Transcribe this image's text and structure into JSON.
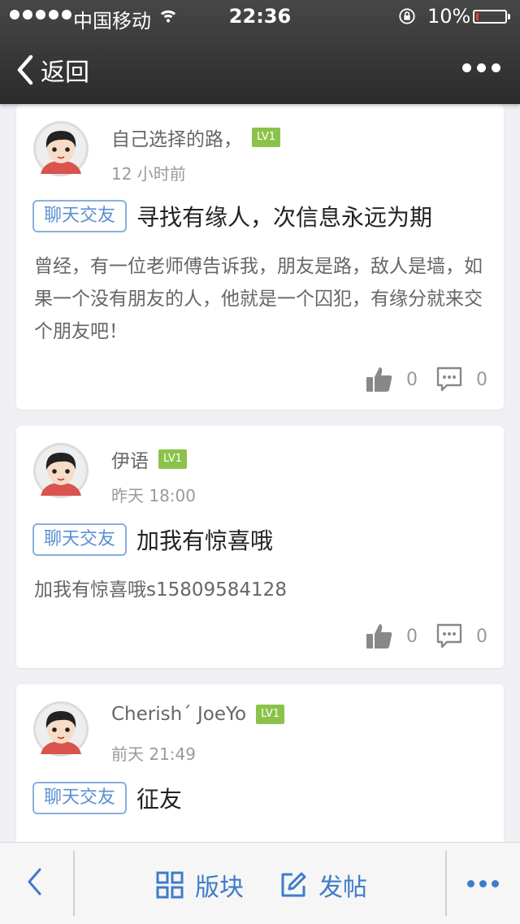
{
  "status": {
    "carrier": "中国移动",
    "time": "22:36",
    "battery": "10%",
    "battery_level": 0.1
  },
  "nav": {
    "back_label": "返回"
  },
  "posts": [
    {
      "author": "自己选择的路，",
      "level": "LV1",
      "time": "12 小时前",
      "tag": "聊天交友",
      "title": "寻找有缘人，次信息永远为期",
      "content": "曾经，有一位老师傅告诉我，朋友是路，敌人是墙，如果一个没有朋友的人，他就是一个囚犯，有缘分就来交个朋友吧！",
      "likes": "0",
      "comments": "0"
    },
    {
      "author": "伊语",
      "level": "LV1",
      "time": "昨天 18:00",
      "tag": "聊天交友",
      "title": "加我有惊喜哦",
      "content": "加我有惊喜哦s15809584128",
      "likes": "0",
      "comments": "0"
    },
    {
      "author": "Cherish´ JoeYo",
      "level": "LV1",
      "time": "前天 21:49",
      "tag": "聊天交友",
      "title": "征友"
    }
  ],
  "tabbar": {
    "board_label": "版块",
    "post_label": "发帖"
  },
  "colors": {
    "accent": "#3f7cc9",
    "level_badge": "#8bc34a",
    "tag_border": "#8ab0dc",
    "battery_low": "#ff3b30"
  }
}
